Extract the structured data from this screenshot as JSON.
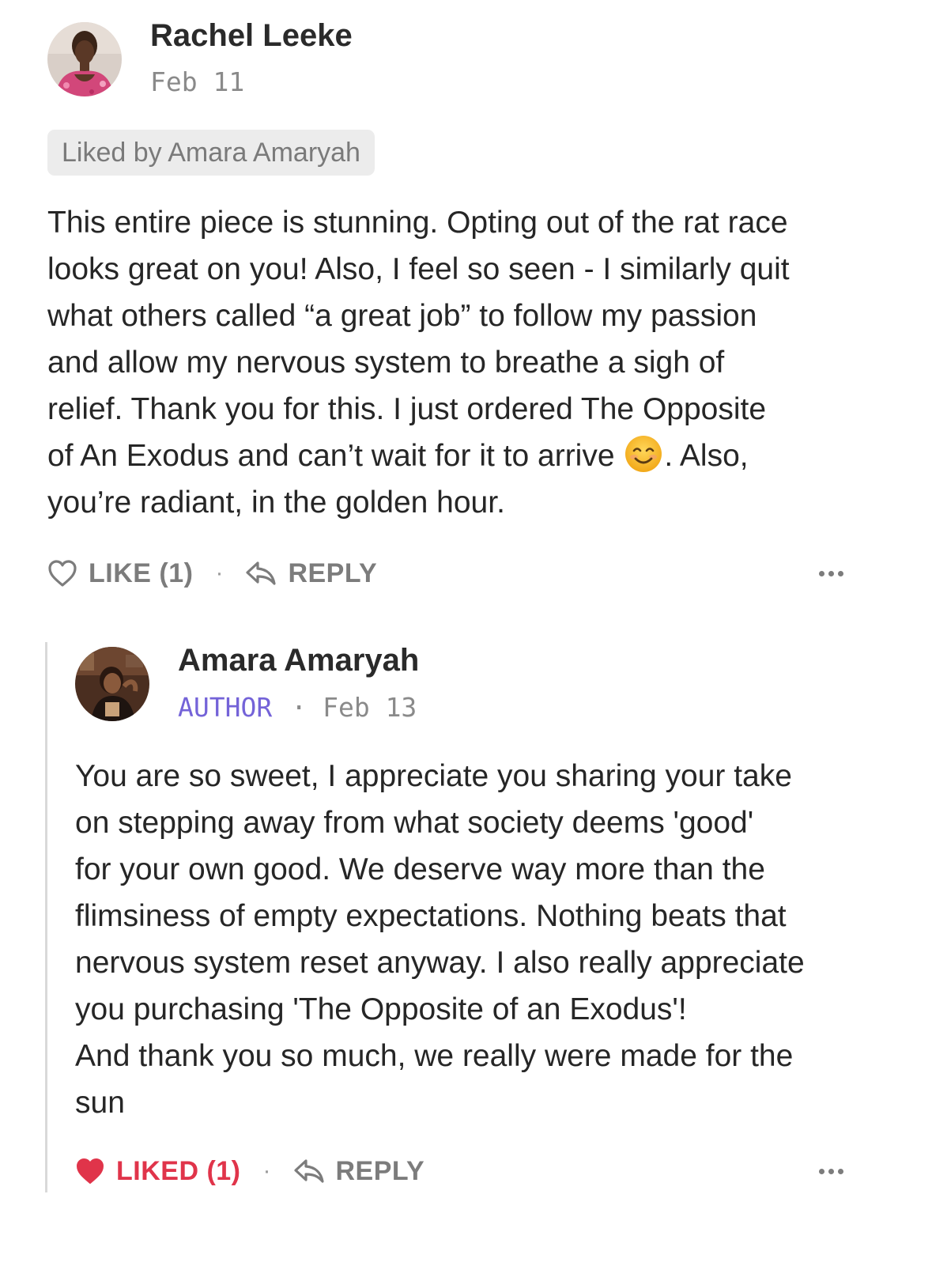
{
  "comment": {
    "author": "Rachel Leeke",
    "date": "Feb 11",
    "liked_by": "Liked by Amara Amaryah",
    "lines": [
      "This entire piece is stunning. Opting out of the rat race",
      "looks great on you! Also, I feel so seen - I similarly quit",
      "what others called “a great  job” to follow my passion",
      "and allow my nervous system to breathe a sigh of",
      "relief.  Thank you for this. I just ordered The Opposite"
    ],
    "line6_before_emoji": "of An Exodus and can’t wait for it to arrive ",
    "line6_after_emoji": ". Also,",
    "line7": "you’re radiant, in the golden hour.",
    "emoji_icon": "smiling-face-emoji",
    "like_label": "LIKE (1)",
    "reply_label": "REPLY",
    "separator": "·"
  },
  "reply": {
    "author": "Amara Amaryah",
    "badge": "AUTHOR",
    "separator": "·",
    "date": "Feb 13",
    "lines": [
      "You are so sweet, I appreciate you sharing your take",
      "on stepping away from what society deems 'good'",
      "for your own good. We deserve way more than the",
      "flimsiness of empty expectations. Nothing beats that",
      "nervous system reset anyway. I also really appreciate",
      "you purchasing 'The Opposite of an Exodus'!",
      "And thank you so much, we really were made for the",
      "sun"
    ],
    "liked_label": "LIKED (1)",
    "reply_label": "REPLY",
    "action_separator": "·"
  },
  "colors": {
    "author_badge": "#7463d8",
    "liked_heart": "#e0344a",
    "muted": "#7c7c7c",
    "liked_by_bg": "#ececec"
  }
}
